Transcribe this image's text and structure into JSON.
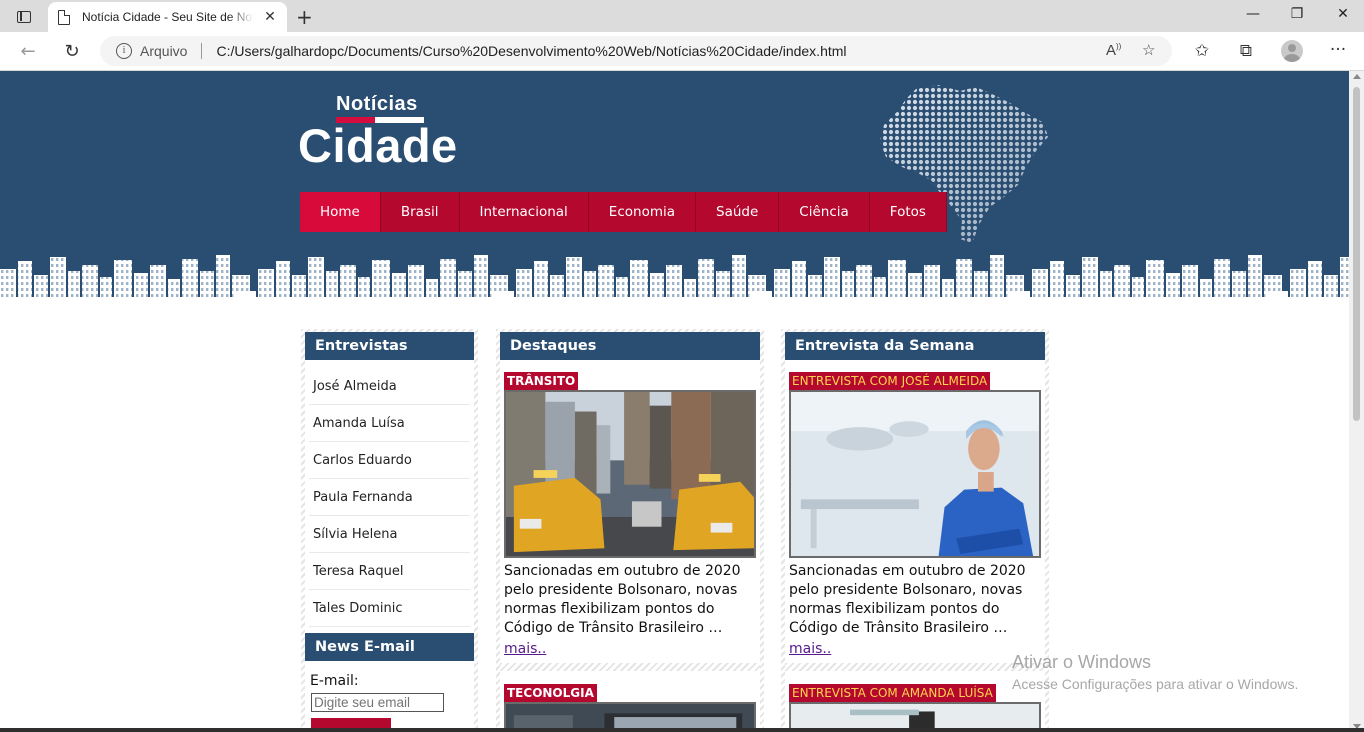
{
  "browser": {
    "tab_title": "Notícia Cidade - Seu Site de Notícias",
    "tab_close": "✕",
    "new_tab": "+",
    "window_controls": {
      "minimize": "—",
      "maximize": "❐",
      "close": "✕"
    },
    "address": {
      "protocol_label": "Arquivo",
      "url": "C:/Users/galhardopc/Documents/Curso%20Desenvolvimento%20Web/Notícias%20Cidade/index.html"
    },
    "icons": [
      "sidebar-toggle-icon",
      "back-icon",
      "reload-icon",
      "info-icon",
      "read-aloud-icon",
      "add-favorite-icon",
      "favorites-icon",
      "collections-icon",
      "profile-icon",
      "more-icon"
    ]
  },
  "site": {
    "logo_top": "Notícias",
    "logo_bottom": "Cidade",
    "menu": [
      {
        "label": "Home",
        "active": true
      },
      {
        "label": "Brasil"
      },
      {
        "label": "Internacional"
      },
      {
        "label": "Economia"
      },
      {
        "label": "Saúde"
      },
      {
        "label": "Ciência"
      },
      {
        "label": "Fotos"
      }
    ],
    "colors": {
      "header": "#2a4d72",
      "menu": "#b5082f",
      "menu_active": "#d80a3a",
      "tag_yellow": "#ffd44d"
    }
  },
  "sidebar": {
    "title": "Entrevistas",
    "items": [
      "José Almeida",
      "Amanda Luísa",
      "Carlos Eduardo",
      "Paula Fernanda",
      "Sílvia Helena",
      "Teresa Raquel",
      "Tales Dominic"
    ],
    "newsletter_title": "News E-mail",
    "email_label": "E-mail:",
    "email_placeholder": "Digite seu email"
  },
  "highlights": {
    "title": "Destaques",
    "stories": [
      {
        "tag": "TRÂNSITO",
        "text": "Sancionadas em outubro de 2020 pelo presidente Bolsonaro, novas normas flexibilizam pontos do Código de Trânsito Brasileiro …",
        "more": "mais.."
      },
      {
        "tag": "TECONOLGIA"
      }
    ]
  },
  "interview_week": {
    "title": "Entrevista da Semana",
    "stories": [
      {
        "tag": "ENTREVISTA COM JOSÉ ALMEIDA",
        "text": "Sancionadas em outubro de 2020 pelo presidente Bolsonaro, novas normas flexibilizam pontos do Código de Trânsito Brasileiro …",
        "more": "mais.."
      },
      {
        "tag": "ENTREVISTA COM AMANDA LUÍSA"
      }
    ]
  },
  "watermark": {
    "line1": "Ativar o Windows",
    "line2": "Acesse Configurações para ativar o Windows."
  }
}
